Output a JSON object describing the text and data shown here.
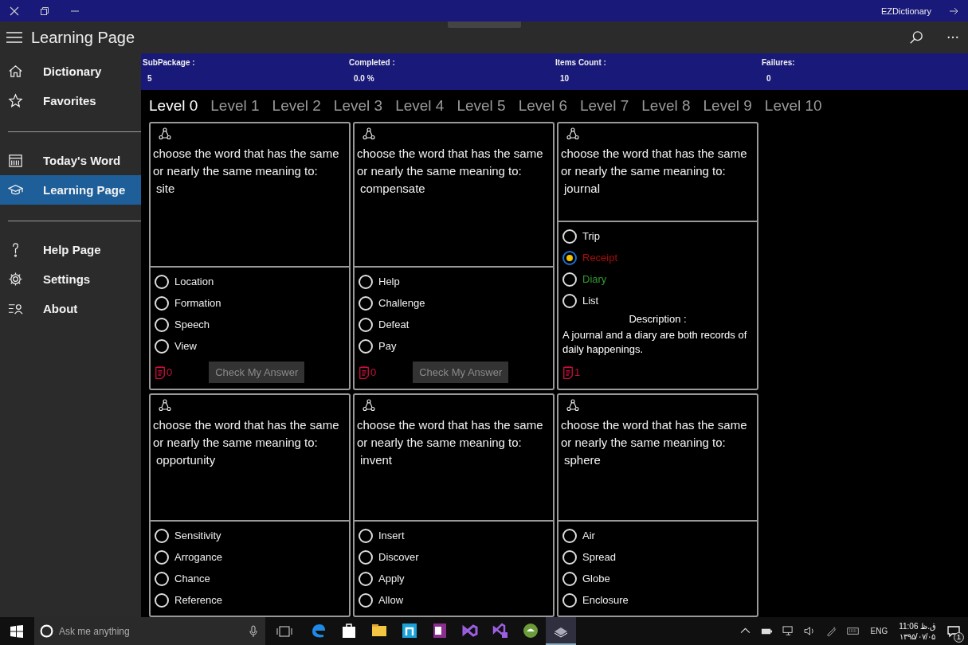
{
  "window": {
    "title": "EZDictionary"
  },
  "app_bar": {
    "title": "Learning Page"
  },
  "sidebar": {
    "groups": [
      [
        {
          "label": "Dictionary",
          "selected": false
        },
        {
          "label": "Favorites",
          "selected": false
        }
      ],
      [
        {
          "label": "Today's Word",
          "selected": false
        },
        {
          "label": "Learning Page",
          "selected": true
        }
      ],
      [
        {
          "label": "Help Page",
          "selected": false
        },
        {
          "label": "Settings",
          "selected": false
        },
        {
          "label": "About",
          "selected": false
        }
      ]
    ]
  },
  "stats": [
    {
      "label": "SubPackage :",
      "value": "5"
    },
    {
      "label": "Completed :",
      "value": "0.0 %"
    },
    {
      "label": "Items Count :",
      "value": "10"
    },
    {
      "label": "Failures:",
      "value": "0"
    }
  ],
  "tabs": [
    {
      "label": "Level 0",
      "selected": true
    },
    {
      "label": "Level 1",
      "selected": false
    },
    {
      "label": "Level 2",
      "selected": false
    },
    {
      "label": "Level 3",
      "selected": false
    },
    {
      "label": "Level 4",
      "selected": false
    },
    {
      "label": "Level 5",
      "selected": false
    },
    {
      "label": "Level 6",
      "selected": false
    },
    {
      "label": "Level 7",
      "selected": false
    },
    {
      "label": "Level 8",
      "selected": false
    },
    {
      "label": "Level 9",
      "selected": false
    },
    {
      "label": "Level 10",
      "selected": false
    }
  ],
  "cards": [
    {
      "question": "choose the word that has the same or nearly the same meaning to:",
      "word": "site",
      "options": [
        {
          "label": "Location",
          "selected": false,
          "wrong": false,
          "correct": false
        },
        {
          "label": "Formation",
          "selected": false,
          "wrong": false,
          "correct": false
        },
        {
          "label": "Speech",
          "selected": false,
          "wrong": false,
          "correct": false
        },
        {
          "label": "View",
          "selected": false,
          "wrong": false,
          "correct": false
        }
      ],
      "attempts": "0",
      "button": {
        "label": "Check My Answer",
        "disabled": true
      }
    },
    {
      "question": "choose the word that has the same or nearly the same meaning to:",
      "word": "compensate",
      "options": [
        {
          "label": "Help",
          "selected": false,
          "wrong": false,
          "correct": false
        },
        {
          "label": "Challenge",
          "selected": false,
          "wrong": false,
          "correct": false
        },
        {
          "label": "Defeat",
          "selected": false,
          "wrong": false,
          "correct": false
        },
        {
          "label": "Pay",
          "selected": false,
          "wrong": false,
          "correct": false
        }
      ],
      "attempts": "0",
      "button": {
        "label": "Check My Answer",
        "disabled": true
      }
    },
    {
      "question": "choose the word that has the same or nearly the same meaning to:",
      "word": "journal",
      "options": [
        {
          "label": "Trip",
          "selected": false,
          "wrong": false,
          "correct": false
        },
        {
          "label": "Receipt",
          "selected": true,
          "wrong": true,
          "correct": false
        },
        {
          "label": "Diary",
          "selected": false,
          "wrong": false,
          "correct": true
        },
        {
          "label": "List",
          "selected": false,
          "wrong": false,
          "correct": false
        }
      ],
      "description_label": "Description :",
      "description": "A journal and a diary are both records of daily happenings.",
      "attempts": "1"
    },
    {
      "question": "choose the word that has the same or nearly the same meaning to:",
      "word": "opportunity",
      "options": [
        {
          "label": "Sensitivity",
          "selected": false,
          "wrong": false,
          "correct": false
        },
        {
          "label": "Arrogance",
          "selected": false,
          "wrong": false,
          "correct": false
        },
        {
          "label": "Chance",
          "selected": false,
          "wrong": false,
          "correct": false
        },
        {
          "label": "Reference",
          "selected": false,
          "wrong": false,
          "correct": false
        }
      ]
    },
    {
      "question": "choose the word that has the same or nearly the same meaning to:",
      "word": "invent",
      "options": [
        {
          "label": "Insert",
          "selected": false,
          "wrong": false,
          "correct": false
        },
        {
          "label": "Discover",
          "selected": false,
          "wrong": false,
          "correct": false
        },
        {
          "label": "Apply",
          "selected": false,
          "wrong": false,
          "correct": false
        },
        {
          "label": "Allow",
          "selected": false,
          "wrong": false,
          "correct": false
        }
      ]
    },
    {
      "question": "choose the word that has the same or nearly the same meaning to:",
      "word": "sphere",
      "options": [
        {
          "label": "Air",
          "selected": false,
          "wrong": false,
          "correct": false
        },
        {
          "label": "Spread",
          "selected": false,
          "wrong": false,
          "correct": false
        },
        {
          "label": "Globe",
          "selected": false,
          "wrong": false,
          "correct": false
        },
        {
          "label": "Enclosure",
          "selected": false,
          "wrong": false,
          "correct": false
        }
      ]
    }
  ],
  "taskbar": {
    "search_placeholder": "Ask me anything",
    "apps": [
      {
        "kind": "edge",
        "active": false
      },
      {
        "kind": "store",
        "active": false
      },
      {
        "kind": "files",
        "active": false
      },
      {
        "kind": "n",
        "active": false
      },
      {
        "kind": "note",
        "active": false
      },
      {
        "kind": "vs",
        "active": false
      },
      {
        "kind": "vsb",
        "active": false
      },
      {
        "kind": "android",
        "active": false
      },
      {
        "kind": "book",
        "active": true
      }
    ],
    "language": "ENG",
    "time": "11:06 ق.ظ",
    "date": "۱۳۹۵/۰۷/۰۵",
    "notifications": "1"
  }
}
